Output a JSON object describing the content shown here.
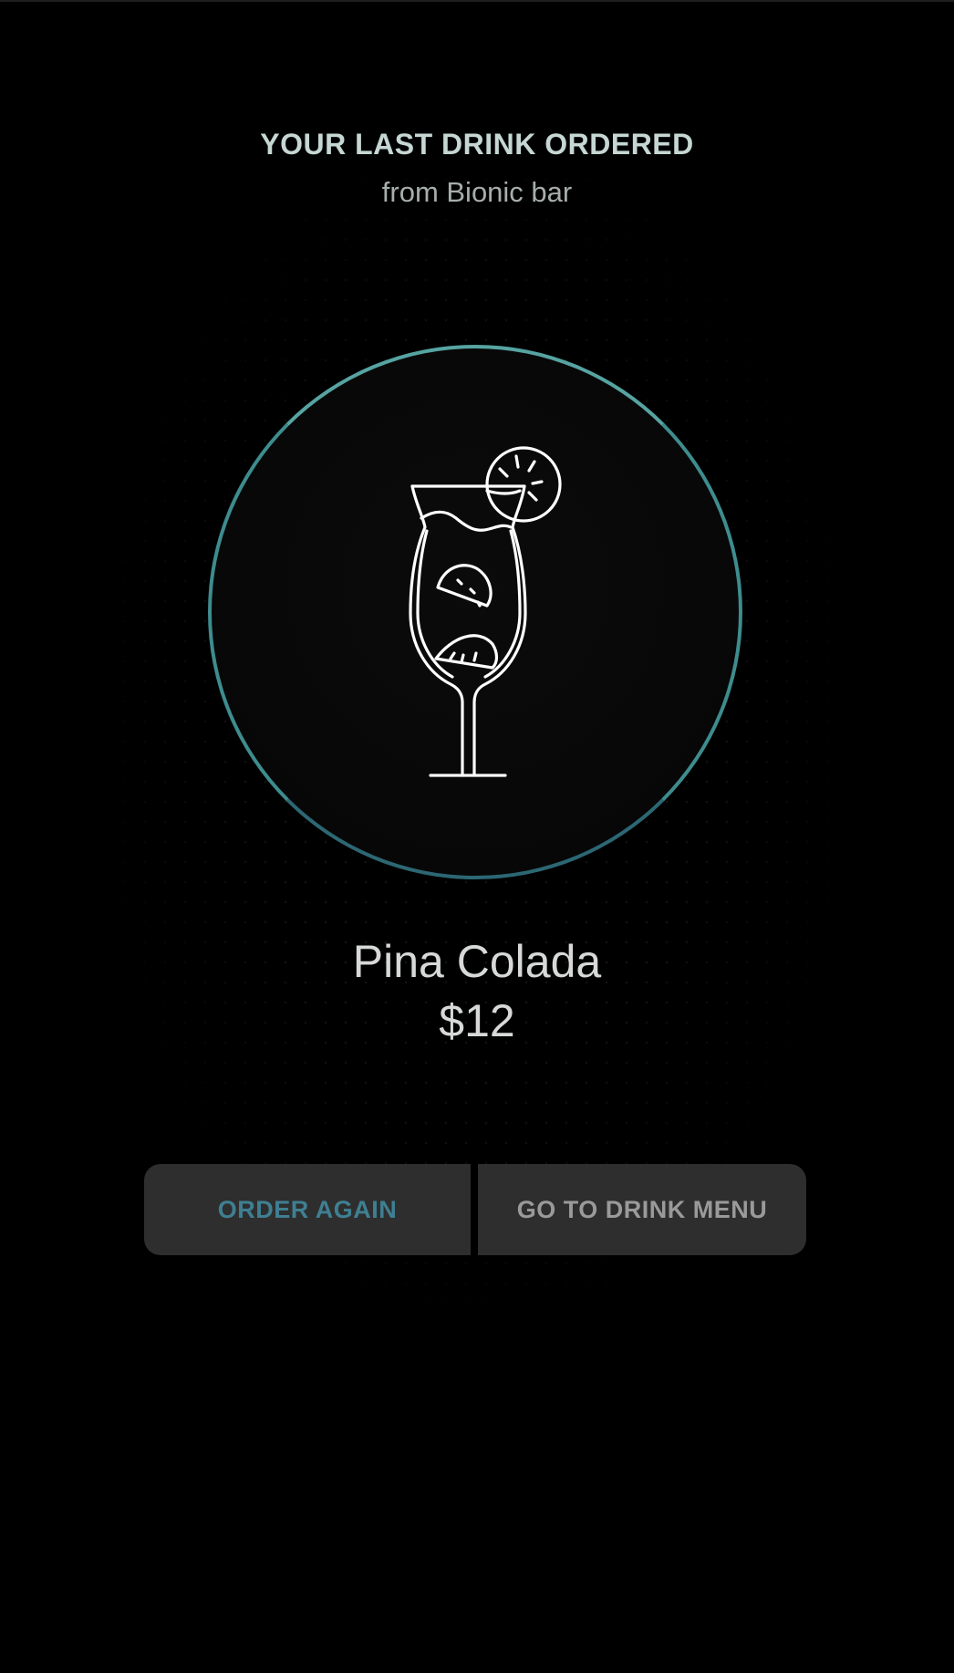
{
  "header": {
    "title": "YOUR LAST DRINK ORDERED",
    "subtitle": "from Bionic bar"
  },
  "drink": {
    "icon": "cocktail-glass-icon",
    "name": "Pina Colada",
    "price": "$12"
  },
  "actions": {
    "order_again_label": "ORDER AGAIN",
    "drink_menu_label": "GO TO DRINK MENU"
  },
  "colors": {
    "background": "#000000",
    "ring": "#3e8c8e",
    "order_again_text": "#3f7f92",
    "menu_text": "#9a9a9a",
    "button_bg": "#2e2e2e"
  }
}
